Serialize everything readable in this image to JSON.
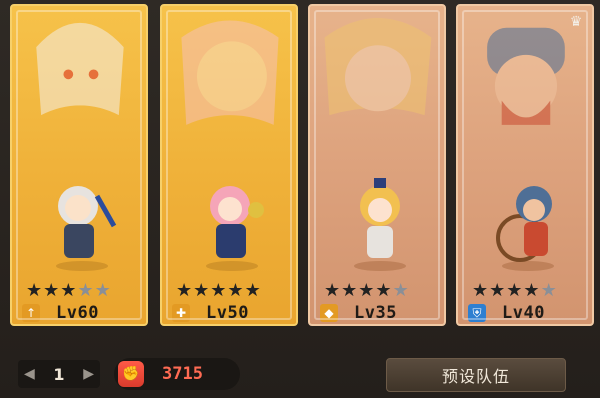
{
  "cards": [
    {
      "level": "Lv60",
      "stars_on": 3,
      "stars_total": 5,
      "card_color": "gold",
      "role_icon": "arrow-up-icon",
      "role_color": "#e39a23"
    },
    {
      "level": "Lv50",
      "stars_on": 5,
      "stars_total": 5,
      "card_color": "gold",
      "role_icon": "cross-icon",
      "role_color": "#e39a23"
    },
    {
      "level": "Lv35",
      "stars_on": 4,
      "stars_total": 5,
      "card_color": "tan",
      "role_icon": "diamond-icon",
      "role_color": "#e39a23"
    },
    {
      "level": "Lv40",
      "stars_on": 4,
      "stars_total": 5,
      "card_color": "tan",
      "role_icon": "shield-icon",
      "role_color": "#2d7fd1"
    }
  ],
  "bottom": {
    "team_index": "1",
    "power_value": "3715",
    "preset_label": "预设队伍"
  }
}
